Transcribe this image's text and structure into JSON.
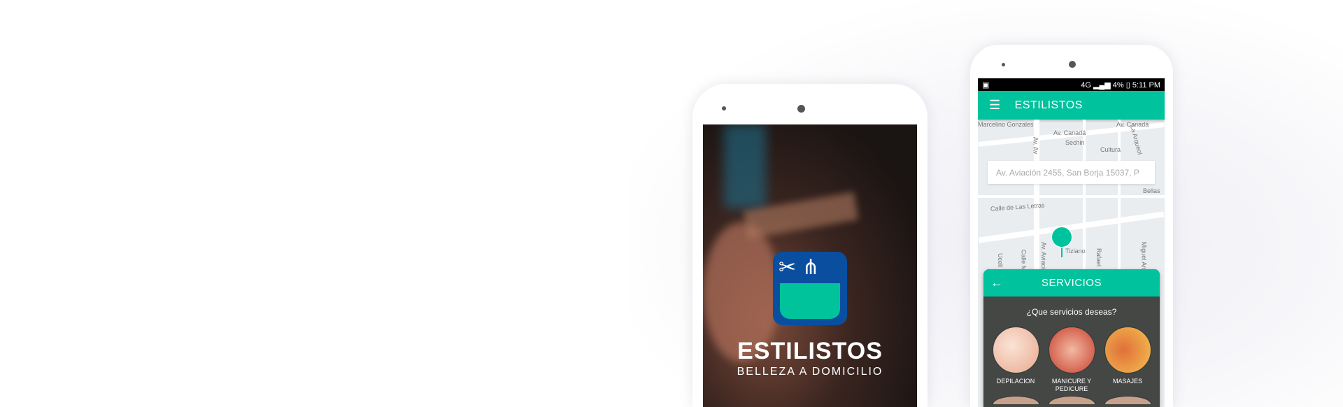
{
  "splash": {
    "brand": "ESTILISTOS",
    "tagline": "BELLEZA A DOMICILIO"
  },
  "status_bar": {
    "network": "4G",
    "battery": "4%",
    "time": "5:11 PM"
  },
  "app_bar": {
    "menu_icon": "hamburger-icon",
    "title": "ESTILISTOS"
  },
  "map": {
    "search_value": "Av. Aviación 2455, San Borja 15037, P",
    "labels": [
      "Marcelino Gonzales",
      "Av. Canadá",
      "Av. Canadá",
      "Sechin",
      "Cultura",
      "La Arqueol",
      "Av. Av",
      "Calle de Las Letras",
      "Bellas",
      "Tiziano",
      "Rafael",
      "Miguel Ang",
      "Av. Aviación",
      "Calle M",
      "Ucell"
    ]
  },
  "services": {
    "title": "SERVICIOS",
    "question": "¿Que servicios deseas?",
    "items": [
      {
        "label": "DEPILACION",
        "color": "#f3c9b5"
      },
      {
        "label": "MANICURE Y PEDICURE",
        "color": "#d9503f"
      },
      {
        "label": "MASAJES",
        "color": "#f0a040"
      }
    ]
  },
  "colors": {
    "accent": "#00c39e",
    "logo_blue": "#0a4ea0",
    "panel": "#454745"
  }
}
